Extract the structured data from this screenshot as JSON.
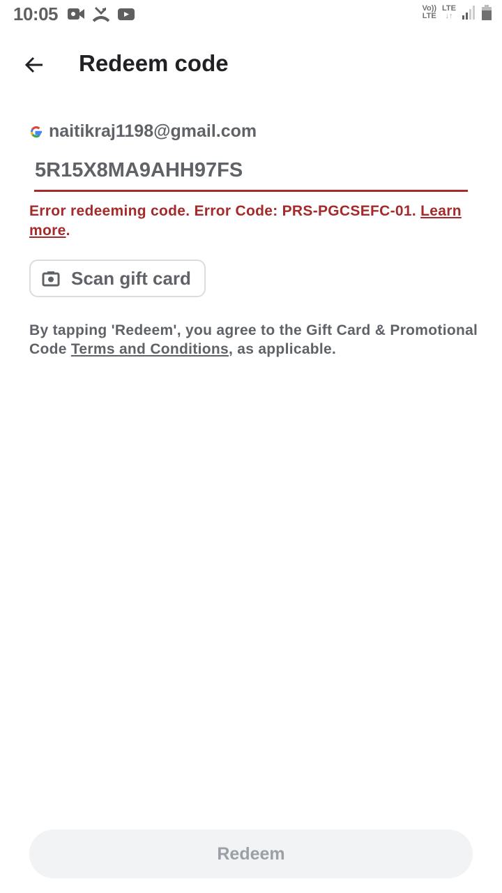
{
  "status_bar": {
    "time": "10:05",
    "left_icons": [
      "video-camera-icon",
      "missed-call-icon",
      "youtube-icon"
    ],
    "volte_label": "Vo))",
    "volte_sub": "LTE",
    "lte_label": "LTE",
    "lte_arrows": "↓↑",
    "right_icons": [
      "volte-icon",
      "lte-data-icon",
      "signal-icon",
      "battery-icon"
    ]
  },
  "app_bar": {
    "back_icon": "arrow-back-icon",
    "title": "Redeem code"
  },
  "account": {
    "icon": "google-g-icon",
    "email": "naitikraj1198@gmail.com"
  },
  "code_input": {
    "value": "5R15X8MA9AHH97FS",
    "underline_color": "#a52a2a"
  },
  "error": {
    "message": "Error redeeming code. Error Code: PRS-PGCSEFC-01.",
    "learn_more": "Learn more",
    "suffix": ".",
    "color": "#a52a2a"
  },
  "scan_button": {
    "icon": "camera-icon",
    "label": "Scan gift card"
  },
  "terms": {
    "prefix": "By tapping 'Redeem', you agree to the Gift Card & Promotional Code ",
    "link": "Terms and Conditions",
    "suffix": ", as applicable."
  },
  "redeem_button": {
    "label": "Redeem",
    "state": "disabled"
  }
}
